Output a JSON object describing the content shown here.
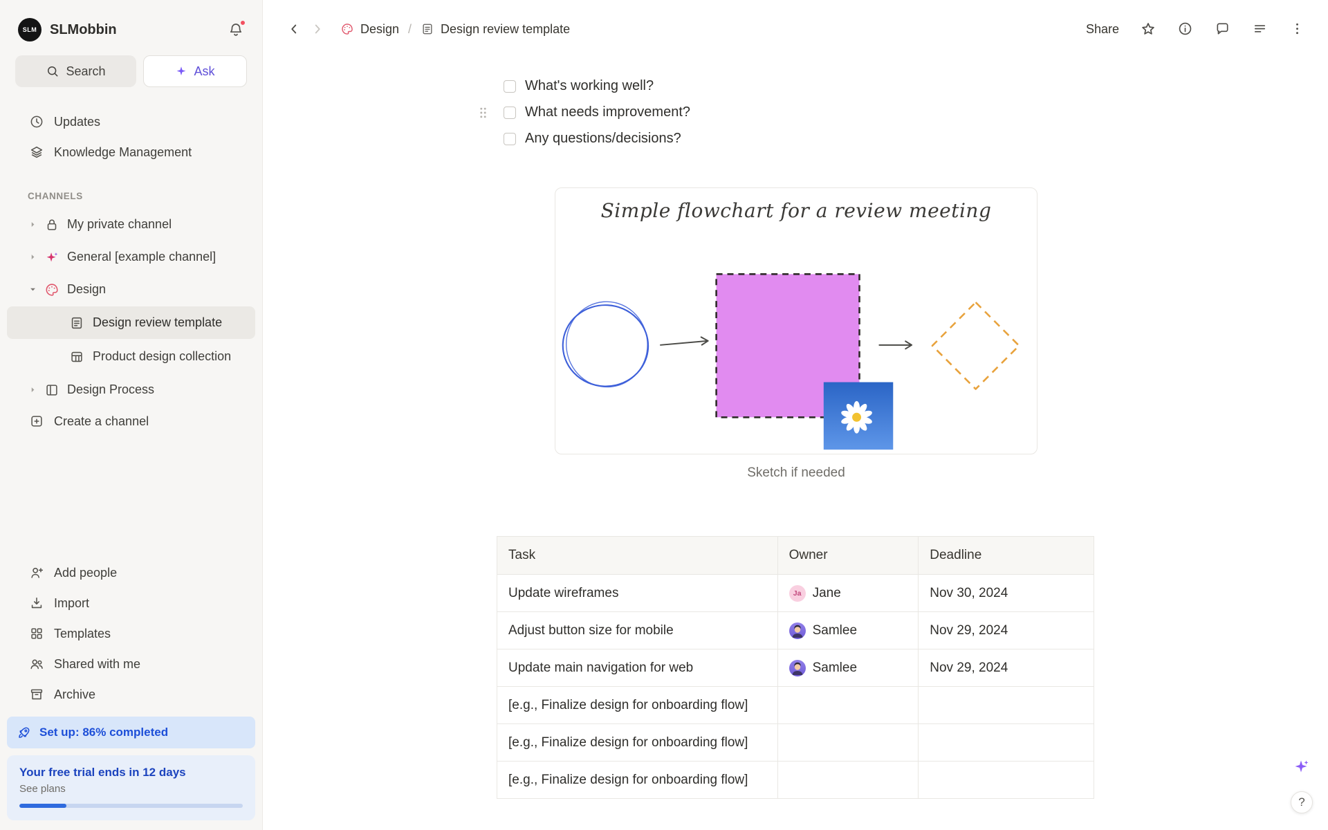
{
  "app": {
    "workspace_name": "SLMobbin",
    "logo_text": "SLM"
  },
  "topbar": {
    "breadcrumb": {
      "channel": "Design",
      "separator": "/",
      "page": "Design review template"
    },
    "share_label": "Share"
  },
  "sidebar": {
    "search_label": "Search",
    "ask_label": "Ask",
    "nav_items": [
      {
        "label": "Updates",
        "icon": "clock-icon"
      },
      {
        "label": "Knowledge Management",
        "icon": "layers-icon"
      }
    ],
    "channels_header": "CHANNELS",
    "channels": [
      {
        "label": "My private channel",
        "icon": "lock-icon",
        "expanded": false
      },
      {
        "label": "General [example channel]",
        "icon": "sparkle-pink-icon",
        "expanded": false
      },
      {
        "label": "Design",
        "icon": "palette-icon",
        "expanded": true
      }
    ],
    "design_pages": [
      {
        "label": "Design review template",
        "icon": "document-icon",
        "selected": true
      },
      {
        "label": "Product design collection",
        "icon": "table-icon",
        "selected": false
      }
    ],
    "more_channels": [
      {
        "label": "Design Process",
        "icon": "board-icon",
        "expanded": false
      }
    ],
    "create_channel_label": "Create a channel",
    "footer_items": [
      {
        "label": "Add people",
        "icon": "add-person-icon"
      },
      {
        "label": "Import",
        "icon": "import-icon"
      },
      {
        "label": "Templates",
        "icon": "templates-icon"
      },
      {
        "label": "Shared with me",
        "icon": "people-icon"
      },
      {
        "label": "Archive",
        "icon": "archive-icon"
      }
    ],
    "setup": {
      "label": "Set up: 86% completed",
      "icon": "rocket-icon"
    },
    "trial": {
      "title": "Your free trial ends in 12 days",
      "link": "See plans",
      "progress_percent": 21
    }
  },
  "content": {
    "checklist": [
      {
        "label": "What's working well?",
        "checked": false
      },
      {
        "label": "What needs improvement?",
        "checked": false
      },
      {
        "label": "Any questions/decisions?",
        "checked": false
      }
    ],
    "sketch": {
      "title": "Simple flowchart for a review meeting",
      "caption": "Sketch if needed",
      "shapes": [
        "hand-drawn-circle",
        "dashed-purple-square",
        "dashed-orange-diamond",
        "daisy-photo"
      ]
    },
    "table": {
      "headers": [
        "Task",
        "Owner",
        "Deadline"
      ],
      "rows": [
        {
          "task": "Update wireframes",
          "owner": "Jane",
          "owner_initials": "Ja",
          "deadline": "Nov 30, 2024"
        },
        {
          "task": "Adjust button size for mobile",
          "owner": "Samlee",
          "deadline": "Nov 29, 2024"
        },
        {
          "task": "Update main navigation for web",
          "owner": "Samlee",
          "deadline": "Nov 29, 2024"
        },
        {
          "task_placeholder": "[e.g., Finalize design for onboarding flow]"
        },
        {
          "task_placeholder": "[e.g., Finalize design for onboarding flow]"
        },
        {
          "task_placeholder": "[e.g., Finalize design for onboarding flow]"
        }
      ]
    }
  },
  "floating": {
    "help_label": "?"
  },
  "colors": {
    "sidebar_bg": "#F7F6F4",
    "accent_purple": "#8B5CF6",
    "ask_purple": "#5F4FD8",
    "setup_blue": "#1D4FD8",
    "flow_square_fill": "#E18BF0",
    "flow_diamond_border": "#E8A23C",
    "flow_circle_stroke": "#3D5FD9",
    "notification_red": "#F25060",
    "avatar_ja_bg": "#F9CFE0"
  },
  "icons": {
    "search-icon": "magnifier",
    "sparkle-icon": "four-point-star",
    "bell-icon": "bell",
    "clock-icon": "clock",
    "layers-icon": "stacked-layers",
    "lock-icon": "padlock",
    "palette-icon": "paint-palette",
    "document-icon": "page-with-lines",
    "table-icon": "grid-table",
    "board-icon": "kanban-board",
    "plus-square-icon": "square-plus",
    "add-person-icon": "person-plus",
    "import-icon": "arrow-into-tray",
    "templates-icon": "four-squares",
    "people-icon": "two-people",
    "archive-icon": "archive-box",
    "rocket-icon": "rocket",
    "help-icon": "question-mark"
  }
}
